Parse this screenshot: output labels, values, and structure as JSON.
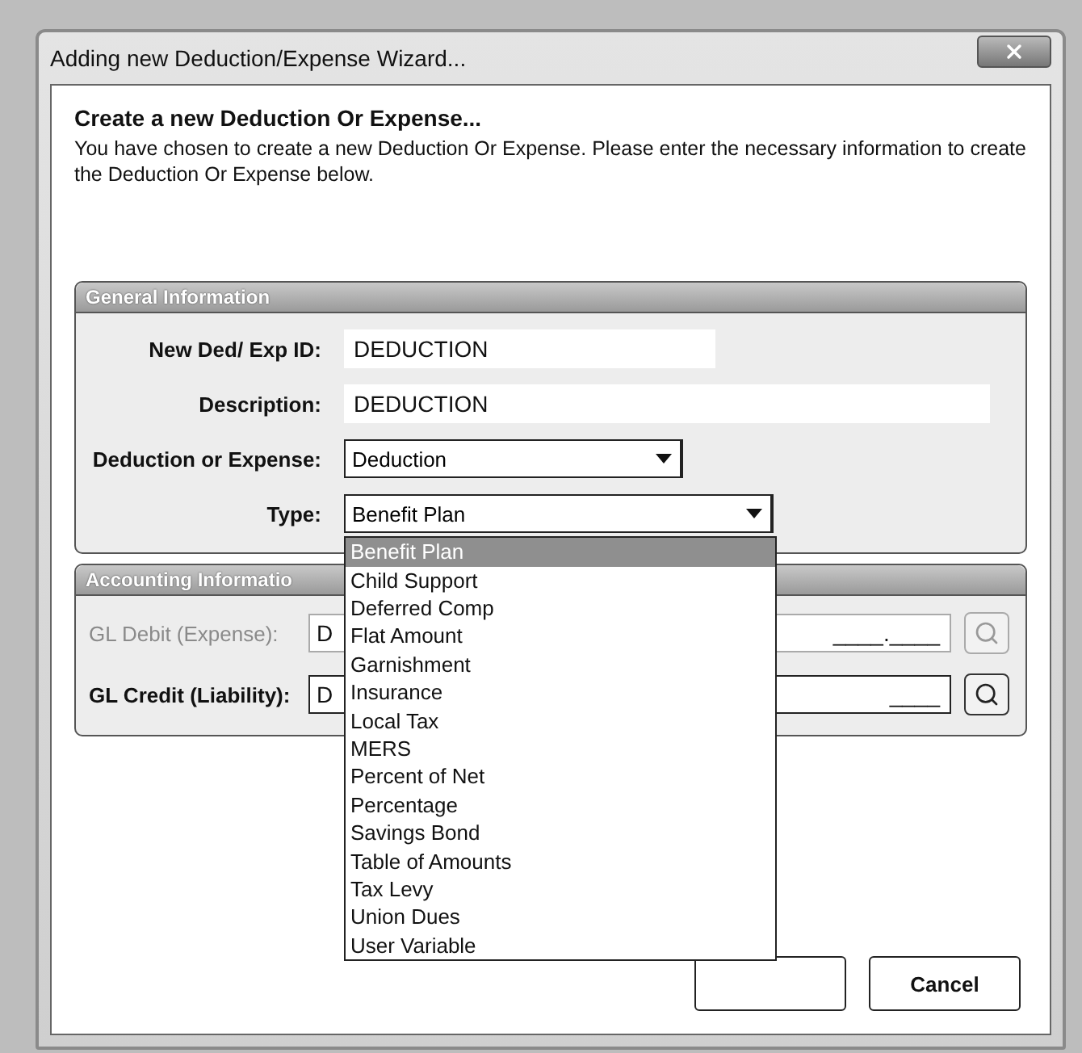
{
  "window": {
    "title": "Adding new Deduction/Expense Wizard..."
  },
  "intro": {
    "heading": "Create a new Deduction Or Expense...",
    "text": "You have chosen to create a new Deduction Or Expense.  Please enter the necessary information to create the Deduction Or Expense below."
  },
  "general": {
    "title": "General Information",
    "fields": [
      {
        "label": "New Ded/ Exp ID:",
        "kind": "text",
        "value": "DEDUCTION"
      },
      {
        "label": "Description:",
        "kind": "text",
        "value": "DEDUCTION"
      },
      {
        "label": "Deduction or Expense:",
        "kind": "combo",
        "value": "Deduction"
      },
      {
        "label": "Type:",
        "kind": "combo",
        "value": "Benefit Plan",
        "expanded": true
      }
    ]
  },
  "type_options": [
    {
      "label": "Benefit Plan",
      "selected": true
    },
    {
      "label": "Child Support",
      "selected": false
    },
    {
      "label": "Deferred Comp",
      "selected": false
    },
    {
      "label": "Flat Amount",
      "selected": false
    },
    {
      "label": "Garnishment",
      "selected": false
    },
    {
      "label": "Insurance",
      "selected": false
    },
    {
      "label": "Local Tax",
      "selected": false
    },
    {
      "label": "MERS",
      "selected": false
    },
    {
      "label": "Percent of Net",
      "selected": false
    },
    {
      "label": "Percentage",
      "selected": false
    },
    {
      "label": "Savings Bond",
      "selected": false
    },
    {
      "label": "Table of Amounts",
      "selected": false
    },
    {
      "label": "Tax Levy",
      "selected": false
    },
    {
      "label": "Union Dues",
      "selected": false
    },
    {
      "label": "User Variable",
      "selected": false
    }
  ],
  "accounting": {
    "title": "Accounting Informatio",
    "fields": [
      {
        "label": "GL Debit (Expense):",
        "value": "D",
        "mask": "____.____",
        "disabled": true
      },
      {
        "label": "GL Credit (Liability):",
        "value": "D",
        "mask": "____",
        "disabled": false
      }
    ]
  },
  "buttons": [
    {
      "label": "Cancel"
    }
  ]
}
